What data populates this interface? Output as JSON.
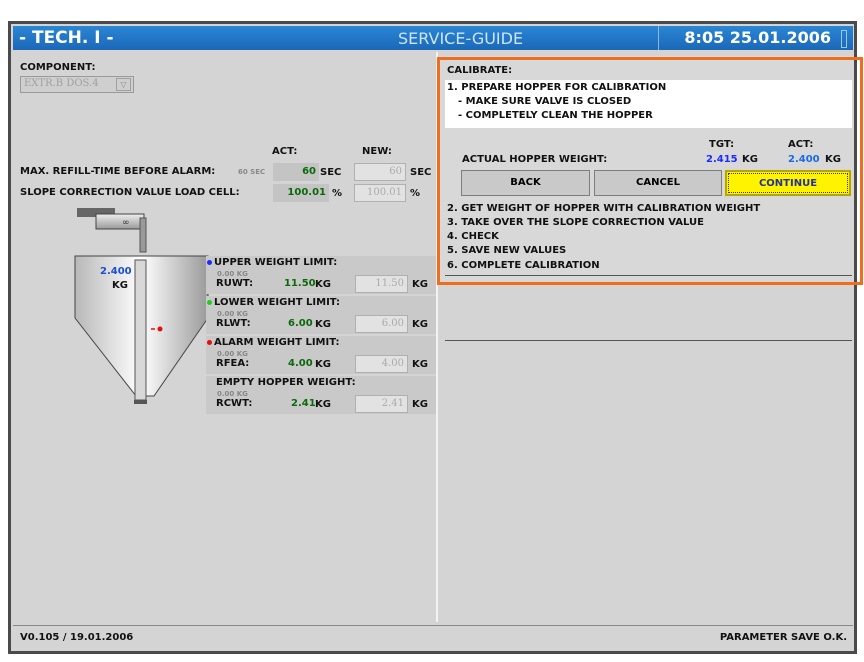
{
  "title_bar": {
    "left": "- TECH. I -",
    "center": "SERVICE-GUIDE",
    "right": "8:05  25.01.2006"
  },
  "component": {
    "label": "COMPONENT:",
    "value": "EXTR.B DOS.4"
  },
  "columns": {
    "act": "ACT:",
    "new": "NEW:"
  },
  "refill": {
    "label": "MAX. REFILL-TIME BEFORE ALARM:",
    "hint": "60 SEC",
    "act": "60",
    "act_unit": "SEC",
    "new": "60",
    "new_unit": "SEC"
  },
  "slope": {
    "label": "SLOPE CORRECTION VALUE LOAD CELL:",
    "act": "100.01",
    "act_unit": "%",
    "new": "100.01",
    "new_unit": "%"
  },
  "hopper": {
    "weight": "2.400",
    "unit": "KG"
  },
  "limits": [
    {
      "title": "UPPER WEIGHT LIMIT:",
      "hint": "0.00 KG",
      "code": "RUWT:",
      "act": "11.50",
      "unit": "KG",
      "new": "11.50",
      "new_unit": "KG",
      "dot_color": "#1a2cff"
    },
    {
      "title": "LOWER WEIGHT LIMIT:",
      "hint": "0.00 KG",
      "code": "RLWT:",
      "act": "6.00",
      "unit": "KG",
      "new": "6.00",
      "new_unit": "KG",
      "dot_color": "#22cc22"
    },
    {
      "title": "ALARM WEIGHT LIMIT:",
      "hint": "0.00 KG",
      "code": "RFEA:",
      "act": "4.00",
      "unit": "KG",
      "new": "4.00",
      "new_unit": "KG",
      "dot_color": "#e01010"
    },
    {
      "title": "EMPTY HOPPER WEIGHT:",
      "hint": "0.00 KG",
      "code": "RCWT:",
      "act": "2.41",
      "unit": "KG",
      "new": "2.41",
      "new_unit": "KG",
      "dot_color": ""
    }
  ],
  "calibrate": {
    "header": "CALIBRATE:",
    "step1": "1. PREPARE HOPPER FOR CALIBRATION",
    "step1_sub1": "- MAKE SURE VALVE IS CLOSED",
    "step1_sub2": "- COMPLETELY CLEAN THE HOPPER",
    "tgt_label": "TGT:",
    "act_label": "ACT:",
    "weight_label": "ACTUAL HOPPER WEIGHT:",
    "tgt_value": "2.415",
    "tgt_unit": "KG",
    "act_value": "2.400",
    "act_unit": "KG",
    "buttons": {
      "back": "BACK",
      "cancel": "CANCEL",
      "continue": "CONTINUE"
    },
    "steps": [
      "2. GET WEIGHT OF HOPPER WITH CALIBRATION WEIGHT",
      "3. TAKE OVER THE SLOPE CORRECTION VALUE",
      "4. CHECK",
      "5. SAVE NEW VALUES",
      "6. COMPLETE CALIBRATION"
    ]
  },
  "status": {
    "version": "V0.105 / 19.01.2006",
    "message": "PARAMETER SAVE O.K."
  },
  "colors": {
    "title_bar": "#1f72c2",
    "continue": "#fff300",
    "highlight": "#ee6e1e",
    "act_blue": "#1a4fd0"
  }
}
